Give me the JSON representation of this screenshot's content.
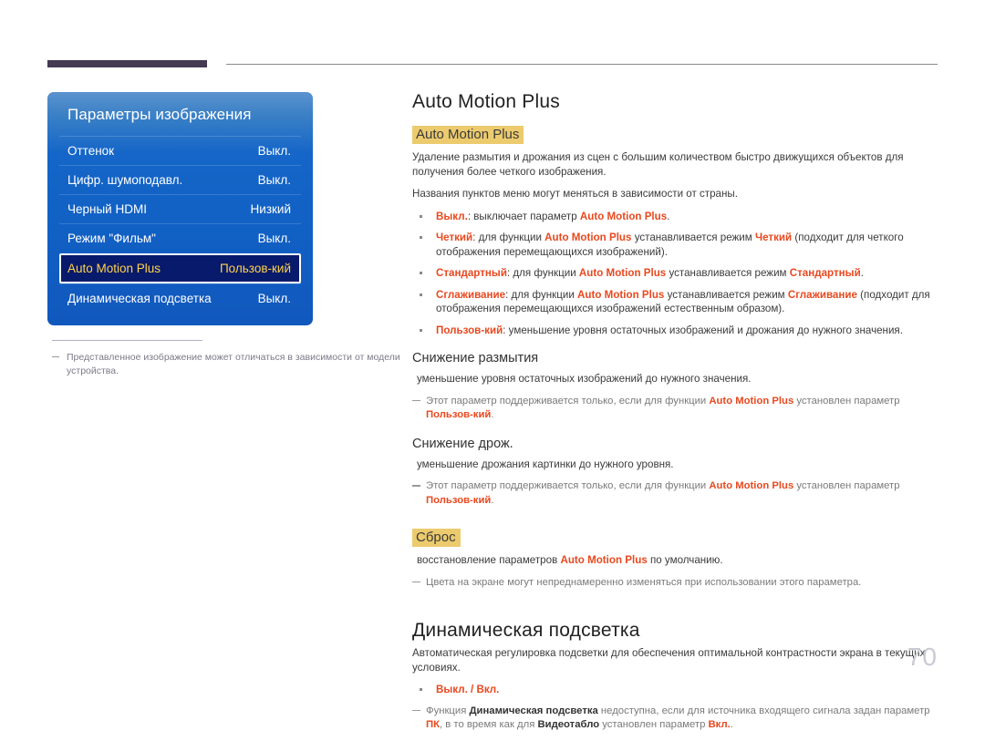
{
  "page": {
    "number": "70"
  },
  "osd": {
    "title": "Параметры изображения",
    "rows": [
      {
        "label": "Оттенок",
        "value": "Выкл."
      },
      {
        "label": "Цифр. шумоподавл.",
        "value": "Выкл."
      },
      {
        "label": "Черный HDMI",
        "value": "Низкий"
      },
      {
        "label": "Режим \"Фильм\"",
        "value": "Выкл."
      },
      {
        "label": "Auto Motion Plus",
        "value": "Пользов-кий",
        "selected": true
      },
      {
        "label": "Динамическая подсветка",
        "value": "Выкл."
      }
    ],
    "note": "Представленное изображение может отличаться в зависимости от модели устройства."
  },
  "content": {
    "title1": "Auto Motion Plus",
    "heading_amp": "Auto Motion Plus",
    "para1": "Удаление размытия и дрожания из сцен с большим количеством быстро движущихся объектов для получения более четкого изображения.",
    "para2": "Названия пунктов меню могут меняться в зависимости от страны.",
    "bullets": [
      {
        "term": "Выкл.",
        "rest_1": ": выключает параметр ",
        "em_1": "Auto Motion Plus",
        "rest_2": "."
      },
      {
        "term": "Четкий",
        "rest_1": ": для функции ",
        "em_1": "Auto Motion Plus",
        "rest_2": " устанавливается режим ",
        "em_2": "Четкий",
        "rest_3": " (подходит для четкого отображения перемещающихся изображений)."
      },
      {
        "term": "Стандартный",
        "rest_1": ": для функции ",
        "em_1": "Auto Motion Plus",
        "rest_2": " устанавливается режим ",
        "em_2": "Стандартный",
        "rest_3": "."
      },
      {
        "term": "Сглаживание",
        "rest_1": ": для функции ",
        "em_1": "Auto Motion Plus",
        "rest_2": " устанавливается режим ",
        "em_2": "Сглаживание",
        "rest_3": " (подходит для отображения перемещающихся изображений естественным образом)."
      },
      {
        "term": "Пользов-кий",
        "rest_1": ": уменьшение уровня остаточных изображений и дрожания до нужного значения.",
        "em_1": "",
        "rest_2": ""
      }
    ],
    "sub1": {
      "heading": "Снижение размытия",
      "body": "уменьшение уровня остаточных изображений до нужного значения.",
      "note_a": "Этот параметр поддерживается только, если для функции ",
      "note_em": "Auto Motion Plus",
      "note_b": " установлен параметр ",
      "note_em2": "Пользов-кий",
      "note_c": "."
    },
    "sub2": {
      "heading": "Снижение дрож.",
      "body": "уменьшение дрожания картинки до нужного уровня.",
      "note_a": "Этот параметр поддерживается только, если для функции ",
      "note_em": "Auto Motion Plus",
      "note_b": " установлен параметр ",
      "note_em2": "Пользов-кий",
      "note_c": "."
    },
    "reset": {
      "heading": "Сброс",
      "body_a": "восстановление параметров ",
      "body_em": "Auto Motion Plus",
      "body_b": " по умолчанию.",
      "note": "Цвета на экране могут непреднамеренно изменяться при использовании этого параметра."
    },
    "title2": "Динамическая подсветка",
    "para3": "Автоматическая регулировка подсветки для обеспечения оптимальной контрастности экрана в текущих условиях.",
    "bullet_onoff": "Выкл. / Вкл.",
    "note_final": {
      "a": "Функция ",
      "em1": "Динамическая подсветка",
      "b": " недоступна, если для источника входящего сигнала задан параметр ",
      "em2": "ПК",
      "c": ", в то время как для ",
      "em3": "Видеотабло",
      "d": " установлен параметр ",
      "em4": "Вкл.",
      "e": "."
    }
  },
  "colors": {
    "accent_red": "#e8491f",
    "highlight_yellow": "#eccb6e",
    "osd_blue": "#1566c8",
    "osd_selected": "#081a6b",
    "osd_selected_text": "#ffd34d",
    "header_block": "#443a52",
    "page_number": "#c9cad4"
  }
}
